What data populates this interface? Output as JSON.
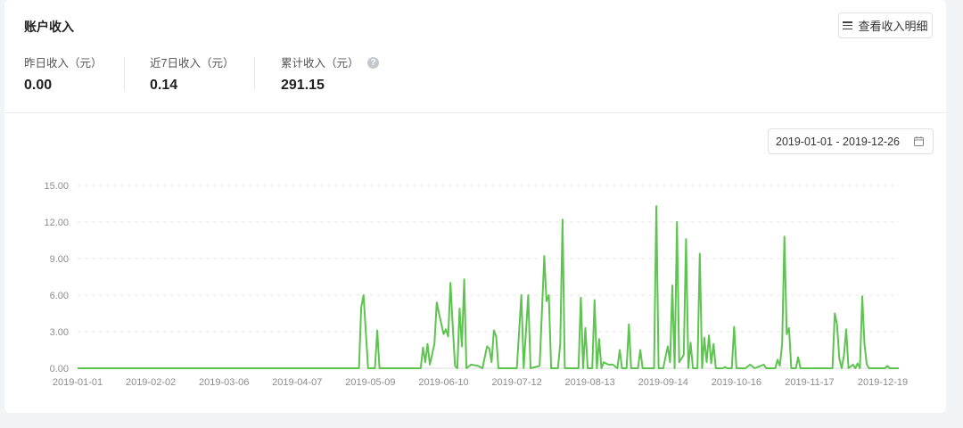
{
  "panel": {
    "title": "账户收入",
    "detail_button": "查看收入明细"
  },
  "stats": [
    {
      "label": "昨日收入（元）",
      "value": "0.00"
    },
    {
      "label": "近7日收入（元）",
      "value": "0.14"
    },
    {
      "label": "累计收入（元）",
      "value": "291.15"
    }
  ],
  "help_icon": "question-circle-icon",
  "date_range": {
    "value": "2019-01-01 - 2019-12-26",
    "icon": "calendar-icon"
  },
  "colors": {
    "line": "#5cc44f",
    "grid": "#e4e4e4",
    "axis_text": "#8c8c8c"
  },
  "chart_data": {
    "type": "line",
    "title": "",
    "xlabel": "",
    "ylabel": "",
    "ylim": [
      0,
      15
    ],
    "y_ticks": [
      "0.00",
      "3.00",
      "6.00",
      "9.00",
      "12.00",
      "15.00"
    ],
    "x_ticks": [
      "2019-01-01",
      "2019-02-02",
      "2019-03-06",
      "2019-04-07",
      "2019-05-09",
      "2019-06-10",
      "2019-07-12",
      "2019-08-13",
      "2019-09-14",
      "2019-10-16",
      "2019-11-17",
      "2019-12-19"
    ],
    "x_range": [
      "2019-01-01",
      "2019-12-26"
    ],
    "grid": true,
    "series": [
      {
        "points": [
          [
            "2019-01-01",
            0
          ],
          [
            "2019-05-04",
            0
          ],
          [
            "2019-05-05",
            5.0
          ],
          [
            "2019-05-06",
            6.0
          ],
          [
            "2019-05-08",
            0
          ],
          [
            "2019-05-11",
            0
          ],
          [
            "2019-05-12",
            3.1
          ],
          [
            "2019-05-13",
            0
          ],
          [
            "2019-05-31",
            0
          ],
          [
            "2019-06-01",
            1.7
          ],
          [
            "2019-06-02",
            0.5
          ],
          [
            "2019-06-03",
            2.0
          ],
          [
            "2019-06-04",
            0.3
          ],
          [
            "2019-06-06",
            2.0
          ],
          [
            "2019-06-07",
            5.4
          ],
          [
            "2019-06-08",
            4.5
          ],
          [
            "2019-06-10",
            2.8
          ],
          [
            "2019-06-11",
            3.2
          ],
          [
            "2019-06-12",
            2.6
          ],
          [
            "2019-06-13",
            7.0
          ],
          [
            "2019-06-14",
            3.5
          ],
          [
            "2019-06-15",
            0.2
          ],
          [
            "2019-06-16",
            0
          ],
          [
            "2019-06-17",
            4.9
          ],
          [
            "2019-06-18",
            1.8
          ],
          [
            "2019-06-19",
            7.3
          ],
          [
            "2019-06-20",
            0
          ],
          [
            "2019-06-22",
            0.3
          ],
          [
            "2019-06-25",
            0.2
          ],
          [
            "2019-06-27",
            0
          ],
          [
            "2019-06-29",
            1.8
          ],
          [
            "2019-06-30",
            1.6
          ],
          [
            "2019-07-01",
            0.5
          ],
          [
            "2019-07-02",
            3.1
          ],
          [
            "2019-07-03",
            2.6
          ],
          [
            "2019-07-04",
            0
          ],
          [
            "2019-07-12",
            0
          ],
          [
            "2019-07-14",
            6.0
          ],
          [
            "2019-07-15",
            0
          ],
          [
            "2019-07-17",
            6.0
          ],
          [
            "2019-07-18",
            0
          ],
          [
            "2019-07-22",
            0.2
          ],
          [
            "2019-07-24",
            9.2
          ],
          [
            "2019-07-25",
            5.5
          ],
          [
            "2019-07-26",
            6.0
          ],
          [
            "2019-07-27",
            0
          ],
          [
            "2019-07-30",
            0
          ],
          [
            "2019-07-31",
            2.0
          ],
          [
            "2019-08-01",
            12.2
          ],
          [
            "2019-08-02",
            0
          ],
          [
            "2019-08-08",
            0
          ],
          [
            "2019-08-09",
            5.8
          ],
          [
            "2019-08-10",
            0
          ],
          [
            "2019-08-11",
            3.3
          ],
          [
            "2019-08-12",
            0
          ],
          [
            "2019-08-14",
            0
          ],
          [
            "2019-08-15",
            5.6
          ],
          [
            "2019-08-16",
            0
          ],
          [
            "2019-08-17",
            2.4
          ],
          [
            "2019-08-18",
            0
          ],
          [
            "2019-08-19",
            0.5
          ],
          [
            "2019-08-21",
            0.3
          ],
          [
            "2019-08-23",
            0.3
          ],
          [
            "2019-08-25",
            0
          ],
          [
            "2019-08-26",
            1.5
          ],
          [
            "2019-08-27",
            0
          ],
          [
            "2019-08-29",
            0
          ],
          [
            "2019-08-30",
            3.6
          ],
          [
            "2019-08-31",
            0
          ],
          [
            "2019-09-03",
            0
          ],
          [
            "2019-09-04",
            1.5
          ],
          [
            "2019-09-05",
            0
          ],
          [
            "2019-09-10",
            0
          ],
          [
            "2019-09-11",
            13.3
          ],
          [
            "2019-09-12",
            0
          ],
          [
            "2019-09-14",
            0
          ],
          [
            "2019-09-15",
            0.9
          ],
          [
            "2019-09-16",
            1.8
          ],
          [
            "2019-09-17",
            0.5
          ],
          [
            "2019-09-18",
            6.8
          ],
          [
            "2019-09-19",
            0
          ],
          [
            "2019-09-20",
            12.0
          ],
          [
            "2019-09-21",
            0.5
          ],
          [
            "2019-09-22",
            0.8
          ],
          [
            "2019-09-23",
            1.1
          ],
          [
            "2019-09-24",
            10.6
          ],
          [
            "2019-09-25",
            0
          ],
          [
            "2019-09-26",
            2.1
          ],
          [
            "2019-09-27",
            0
          ],
          [
            "2019-09-29",
            0
          ],
          [
            "2019-09-30",
            9.4
          ],
          [
            "2019-10-01",
            0
          ],
          [
            "2019-10-02",
            2.5
          ],
          [
            "2019-10-03",
            0.5
          ],
          [
            "2019-10-04",
            2.7
          ],
          [
            "2019-10-05",
            0.4
          ],
          [
            "2019-10-06",
            2.0
          ],
          [
            "2019-10-07",
            0
          ],
          [
            "2019-10-10",
            0
          ],
          [
            "2019-10-11",
            0.1
          ],
          [
            "2019-10-12",
            0
          ],
          [
            "2019-10-14",
            0
          ],
          [
            "2019-10-15",
            3.4
          ],
          [
            "2019-10-16",
            0
          ],
          [
            "2019-10-20",
            0
          ],
          [
            "2019-10-22",
            0.3
          ],
          [
            "2019-10-24",
            0
          ],
          [
            "2019-10-28",
            0.3
          ],
          [
            "2019-10-29",
            0
          ],
          [
            "2019-11-02",
            0
          ],
          [
            "2019-11-03",
            0.7
          ],
          [
            "2019-11-04",
            0.2
          ],
          [
            "2019-11-05",
            2.0
          ],
          [
            "2019-11-06",
            10.8
          ],
          [
            "2019-11-07",
            2.8
          ],
          [
            "2019-11-08",
            3.3
          ],
          [
            "2019-11-09",
            0
          ],
          [
            "2019-11-11",
            0
          ],
          [
            "2019-11-12",
            0.9
          ],
          [
            "2019-11-13",
            0
          ],
          [
            "2019-11-27",
            0
          ],
          [
            "2019-11-28",
            4.5
          ],
          [
            "2019-11-29",
            3.6
          ],
          [
            "2019-11-30",
            0.8
          ],
          [
            "2019-12-01",
            0
          ],
          [
            "2019-12-02",
            1.0
          ],
          [
            "2019-12-03",
            3.2
          ],
          [
            "2019-12-04",
            0
          ],
          [
            "2019-12-06",
            0.3
          ],
          [
            "2019-12-07",
            0
          ],
          [
            "2019-12-08",
            0.4
          ],
          [
            "2019-12-09",
            0
          ],
          [
            "2019-12-10",
            5.9
          ],
          [
            "2019-12-11",
            2.0
          ],
          [
            "2019-12-12",
            0.3
          ],
          [
            "2019-12-13",
            0
          ],
          [
            "2019-12-20",
            0
          ],
          [
            "2019-12-21",
            0.2
          ],
          [
            "2019-12-22",
            0
          ],
          [
            "2019-12-26",
            0
          ]
        ]
      }
    ]
  }
}
